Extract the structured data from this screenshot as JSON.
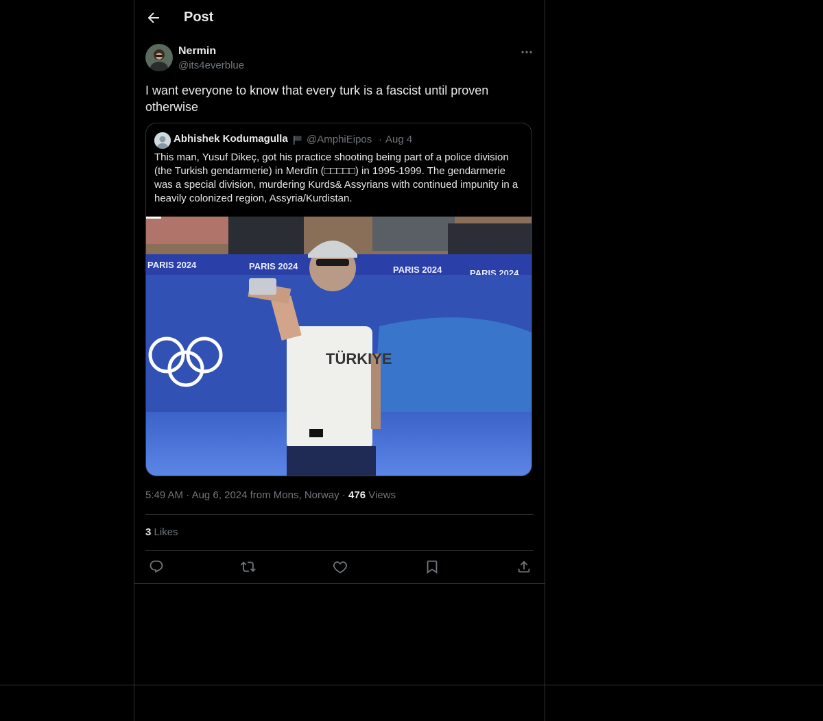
{
  "header": {
    "title": "Post"
  },
  "post": {
    "author_name": "Nermin",
    "author_handle": "@its4everblue",
    "text": "I want everyone to know that every turk is a fascist until proven otherwise",
    "time": "5:49 AM",
    "date_location": "Aug 6, 2024 from Mons, Norway",
    "views_count": "476",
    "views_label": "Views",
    "likes_count": "3",
    "likes_label": "Likes"
  },
  "quote": {
    "author_name": "Abhishek Kodumagulla",
    "author_handle": "@AmphiEipos",
    "separator": "·",
    "date": "Aug 4",
    "text": "This man, Yusuf Dikeç, got his practice shooting being part of a police division (the Turkish gendarmerie) in Merdīn (□□□□□) in 1995-1999. The gendarmerie was a special division, murdering Kurds& Assyrians with continued impunity in a heavily colonized region, Assyria/Kurdistan.",
    "image_banner_text": "PARIS 2024",
    "image_shirt_text": "TÜRKIYE"
  },
  "meta_separator": "·",
  "colors": {
    "background": "#000000",
    "text_primary": "#e7e9ea",
    "text_secondary": "#71767b",
    "border": "#2f3336"
  },
  "icons": {
    "back": "arrow-left-icon",
    "more": "more-horizontal-icon",
    "reply": "reply-icon",
    "repost": "repost-icon",
    "like": "heart-icon",
    "bookmark": "bookmark-icon",
    "share": "share-icon"
  }
}
